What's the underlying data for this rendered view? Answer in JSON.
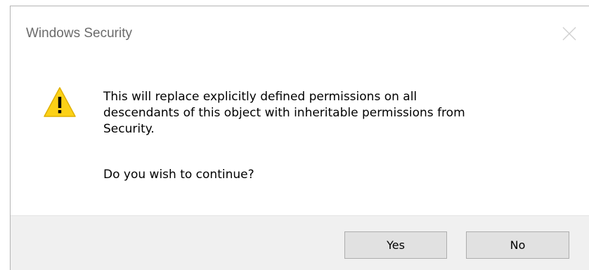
{
  "window": {
    "title": "Windows Security"
  },
  "dialog": {
    "icon": "warning-icon",
    "message_lines": [
      "This will replace explicitly defined permissions on all",
      "descendants of this object with inheritable permissions from",
      "Security."
    ],
    "question": "Do you wish to continue?"
  },
  "buttons": {
    "yes_label": "Yes",
    "no_label": "No"
  },
  "colors": {
    "warning_yellow": "#fcd116",
    "footer_background": "#f0f0f0",
    "button_background": "#e1e1e1",
    "title_text": "#6b6b6b"
  }
}
